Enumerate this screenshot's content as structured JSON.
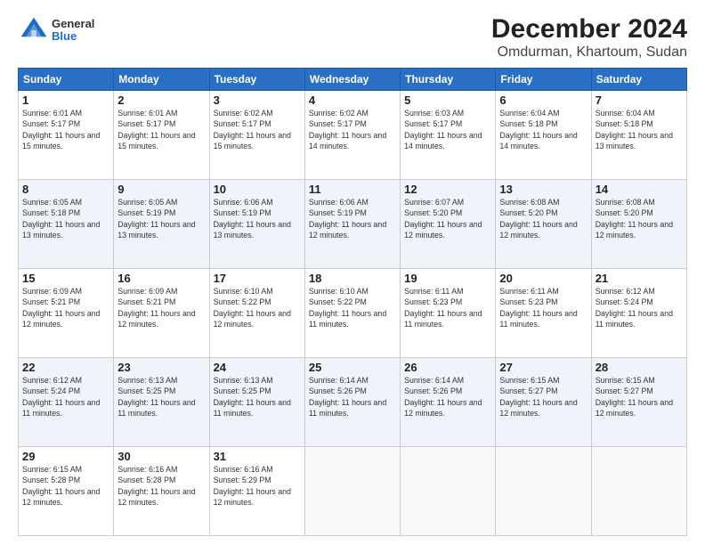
{
  "header": {
    "logo_general": "General",
    "logo_blue": "Blue",
    "title": "December 2024",
    "subtitle": "Omdurman, Khartoum, Sudan"
  },
  "columns": [
    "Sunday",
    "Monday",
    "Tuesday",
    "Wednesday",
    "Thursday",
    "Friday",
    "Saturday"
  ],
  "weeks": [
    [
      {
        "day": "1",
        "rise": "6:01 AM",
        "set": "5:17 PM",
        "daylight": "11 hours and 15 minutes."
      },
      {
        "day": "2",
        "rise": "6:01 AM",
        "set": "5:17 PM",
        "daylight": "11 hours and 15 minutes."
      },
      {
        "day": "3",
        "rise": "6:02 AM",
        "set": "5:17 PM",
        "daylight": "11 hours and 15 minutes."
      },
      {
        "day": "4",
        "rise": "6:02 AM",
        "set": "5:17 PM",
        "daylight": "11 hours and 14 minutes."
      },
      {
        "day": "5",
        "rise": "6:03 AM",
        "set": "5:17 PM",
        "daylight": "11 hours and 14 minutes."
      },
      {
        "day": "6",
        "rise": "6:04 AM",
        "set": "5:18 PM",
        "daylight": "11 hours and 14 minutes."
      },
      {
        "day": "7",
        "rise": "6:04 AM",
        "set": "5:18 PM",
        "daylight": "11 hours and 13 minutes."
      }
    ],
    [
      {
        "day": "8",
        "rise": "6:05 AM",
        "set": "5:18 PM",
        "daylight": "11 hours and 13 minutes."
      },
      {
        "day": "9",
        "rise": "6:05 AM",
        "set": "5:19 PM",
        "daylight": "11 hours and 13 minutes."
      },
      {
        "day": "10",
        "rise": "6:06 AM",
        "set": "5:19 PM",
        "daylight": "11 hours and 13 minutes."
      },
      {
        "day": "11",
        "rise": "6:06 AM",
        "set": "5:19 PM",
        "daylight": "11 hours and 12 minutes."
      },
      {
        "day": "12",
        "rise": "6:07 AM",
        "set": "5:20 PM",
        "daylight": "11 hours and 12 minutes."
      },
      {
        "day": "13",
        "rise": "6:08 AM",
        "set": "5:20 PM",
        "daylight": "11 hours and 12 minutes."
      },
      {
        "day": "14",
        "rise": "6:08 AM",
        "set": "5:20 PM",
        "daylight": "11 hours and 12 minutes."
      }
    ],
    [
      {
        "day": "15",
        "rise": "6:09 AM",
        "set": "5:21 PM",
        "daylight": "11 hours and 12 minutes."
      },
      {
        "day": "16",
        "rise": "6:09 AM",
        "set": "5:21 PM",
        "daylight": "11 hours and 12 minutes."
      },
      {
        "day": "17",
        "rise": "6:10 AM",
        "set": "5:22 PM",
        "daylight": "11 hours and 12 minutes."
      },
      {
        "day": "18",
        "rise": "6:10 AM",
        "set": "5:22 PM",
        "daylight": "11 hours and 11 minutes."
      },
      {
        "day": "19",
        "rise": "6:11 AM",
        "set": "5:23 PM",
        "daylight": "11 hours and 11 minutes."
      },
      {
        "day": "20",
        "rise": "6:11 AM",
        "set": "5:23 PM",
        "daylight": "11 hours and 11 minutes."
      },
      {
        "day": "21",
        "rise": "6:12 AM",
        "set": "5:24 PM",
        "daylight": "11 hours and 11 minutes."
      }
    ],
    [
      {
        "day": "22",
        "rise": "6:12 AM",
        "set": "5:24 PM",
        "daylight": "11 hours and 11 minutes."
      },
      {
        "day": "23",
        "rise": "6:13 AM",
        "set": "5:25 PM",
        "daylight": "11 hours and 11 minutes."
      },
      {
        "day": "24",
        "rise": "6:13 AM",
        "set": "5:25 PM",
        "daylight": "11 hours and 11 minutes."
      },
      {
        "day": "25",
        "rise": "6:14 AM",
        "set": "5:26 PM",
        "daylight": "11 hours and 11 minutes."
      },
      {
        "day": "26",
        "rise": "6:14 AM",
        "set": "5:26 PM",
        "daylight": "11 hours and 12 minutes."
      },
      {
        "day": "27",
        "rise": "6:15 AM",
        "set": "5:27 PM",
        "daylight": "11 hours and 12 minutes."
      },
      {
        "day": "28",
        "rise": "6:15 AM",
        "set": "5:27 PM",
        "daylight": "11 hours and 12 minutes."
      }
    ],
    [
      {
        "day": "29",
        "rise": "6:15 AM",
        "set": "5:28 PM",
        "daylight": "11 hours and 12 minutes."
      },
      {
        "day": "30",
        "rise": "6:16 AM",
        "set": "5:28 PM",
        "daylight": "11 hours and 12 minutes."
      },
      {
        "day": "31",
        "rise": "6:16 AM",
        "set": "5:29 PM",
        "daylight": "11 hours and 12 minutes."
      },
      null,
      null,
      null,
      null
    ]
  ]
}
